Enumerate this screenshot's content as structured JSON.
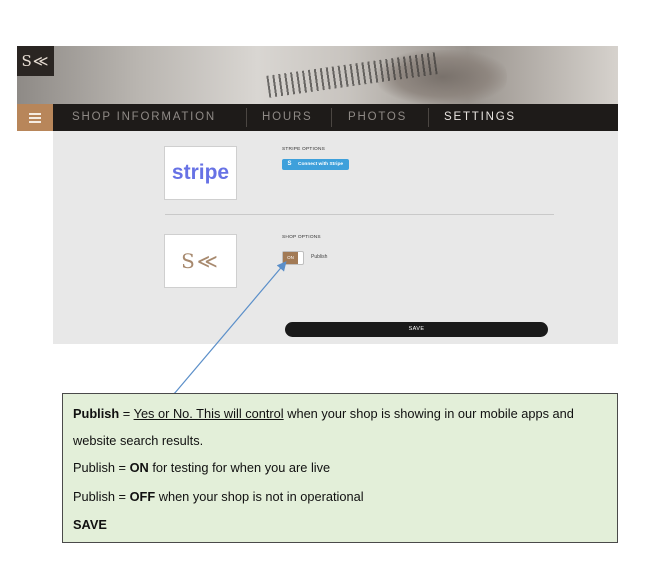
{
  "brand": {
    "logo_text": "S≪"
  },
  "nav": {
    "menu_icon": "hamburger-icon",
    "tabs": [
      {
        "label": "SHOP INFORMATION",
        "active": false
      },
      {
        "label": "HOURS",
        "active": false
      },
      {
        "label": "PHOTOS",
        "active": false
      },
      {
        "label": "SETTINGS",
        "active": true
      }
    ]
  },
  "stripe_section": {
    "logo_text": "stripe",
    "heading": "STRIPE OPTIONS",
    "button_icon": "S",
    "button_label": "Connect with Stripe"
  },
  "shop_section": {
    "logo_text": "S≪",
    "heading": "SHOP OPTIONS",
    "toggle_state": "ON",
    "toggle_label": "Publish"
  },
  "save_label": "SAVE",
  "note": {
    "line1_bold": "Publish",
    "line1_eq": " = ",
    "line1_underlined": "Yes or No. This will control",
    "line1_rest": " when your shop is showing in our mobile apps and",
    "line2": "website search results.",
    "line3_prefix": "Publish = ",
    "line3_bold": "ON",
    "line3_rest": " for testing for when you are live",
    "line4_prefix": "Publish = ",
    "line4_bold": "OFF",
    "line4_rest": " when your shop is not in operational",
    "line5_bold": "SAVE"
  },
  "colors": {
    "nav_bg": "#1e1b19",
    "menu_accent": "#b8865a",
    "stripe_blue": "#3ea0db",
    "note_bg": "#e3efd9",
    "arrow": "#5b8fc9"
  }
}
